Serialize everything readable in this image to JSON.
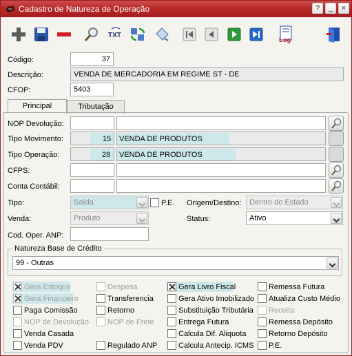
{
  "window": {
    "title": "Cadastro de Natureza de Operação",
    "btn_help": "?",
    "btn_min": "_",
    "btn_close": "×"
  },
  "toolbar": {
    "icons": [
      "add-icon",
      "save-icon",
      "delete-icon",
      "search-icon",
      "txt-icon",
      "refresh-icon",
      "edit-icon",
      "first-icon",
      "previous-icon",
      "next-icon",
      "last-icon",
      "log-icon",
      "exit-icon"
    ],
    "txt_label": "TXT",
    "log_label": "og"
  },
  "form": {
    "codigo_label": "Código:",
    "codigo_value": "37",
    "descricao_label": "Descrição:",
    "descricao_value": "VENDA DE MERCADORIA EM REGIME ST - DE",
    "cfop_label": "CFOP:",
    "cfop_value": "5403"
  },
  "tabs": [
    "Principal",
    "Tributação"
  ],
  "principal": {
    "nop_devolucao_label": "NOP Devolução:",
    "tipo_movimento_label": "Tipo Movimento:",
    "tipo_movimento_code": "15",
    "tipo_movimento_desc": "VENDA DE PRODUTOS",
    "tipo_operacao_label": "Tipo Operação:",
    "tipo_operacao_code": "28",
    "tipo_operacao_desc": "VENDA DE PRODUTOS",
    "cfps_label": "CFPS:",
    "conta_contabil_label": "Conta Contábil:",
    "tipo_label": "Tipo:",
    "tipo_value": "Saída",
    "pe_label": "P.E.",
    "origem_label": "Origem/Destino:",
    "origem_value": "Dentro do Estado",
    "venda_label": "Venda:",
    "venda_value": "Produto",
    "status_label": "Status:",
    "status_value": "Ativo",
    "anp_label": "Cod. Oper. ANP:",
    "natureza_group_title": "Natureza Base de Crédito",
    "natureza_value": "99 - Outras"
  },
  "checkboxes": [
    {
      "label": "Gera Estoque",
      "checked": true,
      "disabled": true
    },
    {
      "label": "Despesa",
      "checked": false,
      "disabled": true
    },
    {
      "label": "Gera Livro Fiscal",
      "checked": true,
      "disabled": false
    },
    {
      "label": "Remessa Futura",
      "checked": false,
      "disabled": false
    },
    {
      "label": "Gera Financeiro",
      "checked": true,
      "disabled": true
    },
    {
      "label": "Transferencia",
      "checked": false,
      "disabled": false
    },
    {
      "label": "Gera Ativo Imobilizado",
      "checked": false,
      "disabled": false
    },
    {
      "label": "Atualiza Custo Médio",
      "checked": false,
      "disabled": false
    },
    {
      "label": "Paga Comissão",
      "checked": false,
      "disabled": false
    },
    {
      "label": "Retorno",
      "checked": false,
      "disabled": false
    },
    {
      "label": "Substituição Tributária",
      "checked": false,
      "disabled": false
    },
    {
      "label": "Receita",
      "checked": false,
      "disabled": true
    },
    {
      "label": "NOP de Devolução",
      "checked": false,
      "disabled": true
    },
    {
      "label": "NOP de Frete",
      "checked": false,
      "disabled": true
    },
    {
      "label": "Entrega Futura",
      "checked": false,
      "disabled": false
    },
    {
      "label": "Remessa Depósito",
      "checked": false,
      "disabled": false
    },
    {
      "label": "Venda Casada",
      "checked": false,
      "disabled": false
    },
    {
      "label": "Calcula Dif. Aliquota",
      "checked": false,
      "disabled": false
    },
    {
      "label": "Retorno Depósito",
      "checked": false,
      "disabled": false
    },
    {
      "label": "Venda PDV",
      "checked": false,
      "disabled": false
    },
    {
      "label": "Regulado ANP",
      "checked": false,
      "disabled": false
    },
    {
      "label": "Calcula Antecip. ICMS",
      "checked": false,
      "disabled": false
    },
    {
      "label": "P.E.",
      "checked": false,
      "disabled": false
    }
  ]
}
